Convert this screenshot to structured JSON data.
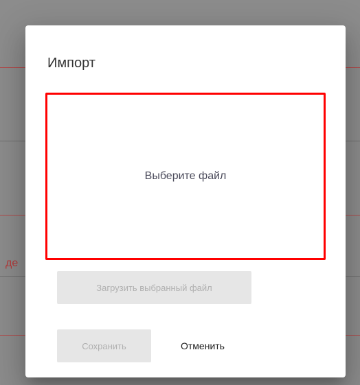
{
  "background": {
    "partial_text": "де"
  },
  "dialog": {
    "title": "Импорт",
    "dropzone_label": "Выберите файл",
    "upload_button": "Загрузить выбранный файл",
    "save_button": "Сохранить",
    "cancel_button": "Отменить"
  },
  "colors": {
    "dropzone_border": "#ff0000",
    "disabled_button_bg": "#e6e6e6",
    "disabled_button_text": "#b0b0b0"
  }
}
